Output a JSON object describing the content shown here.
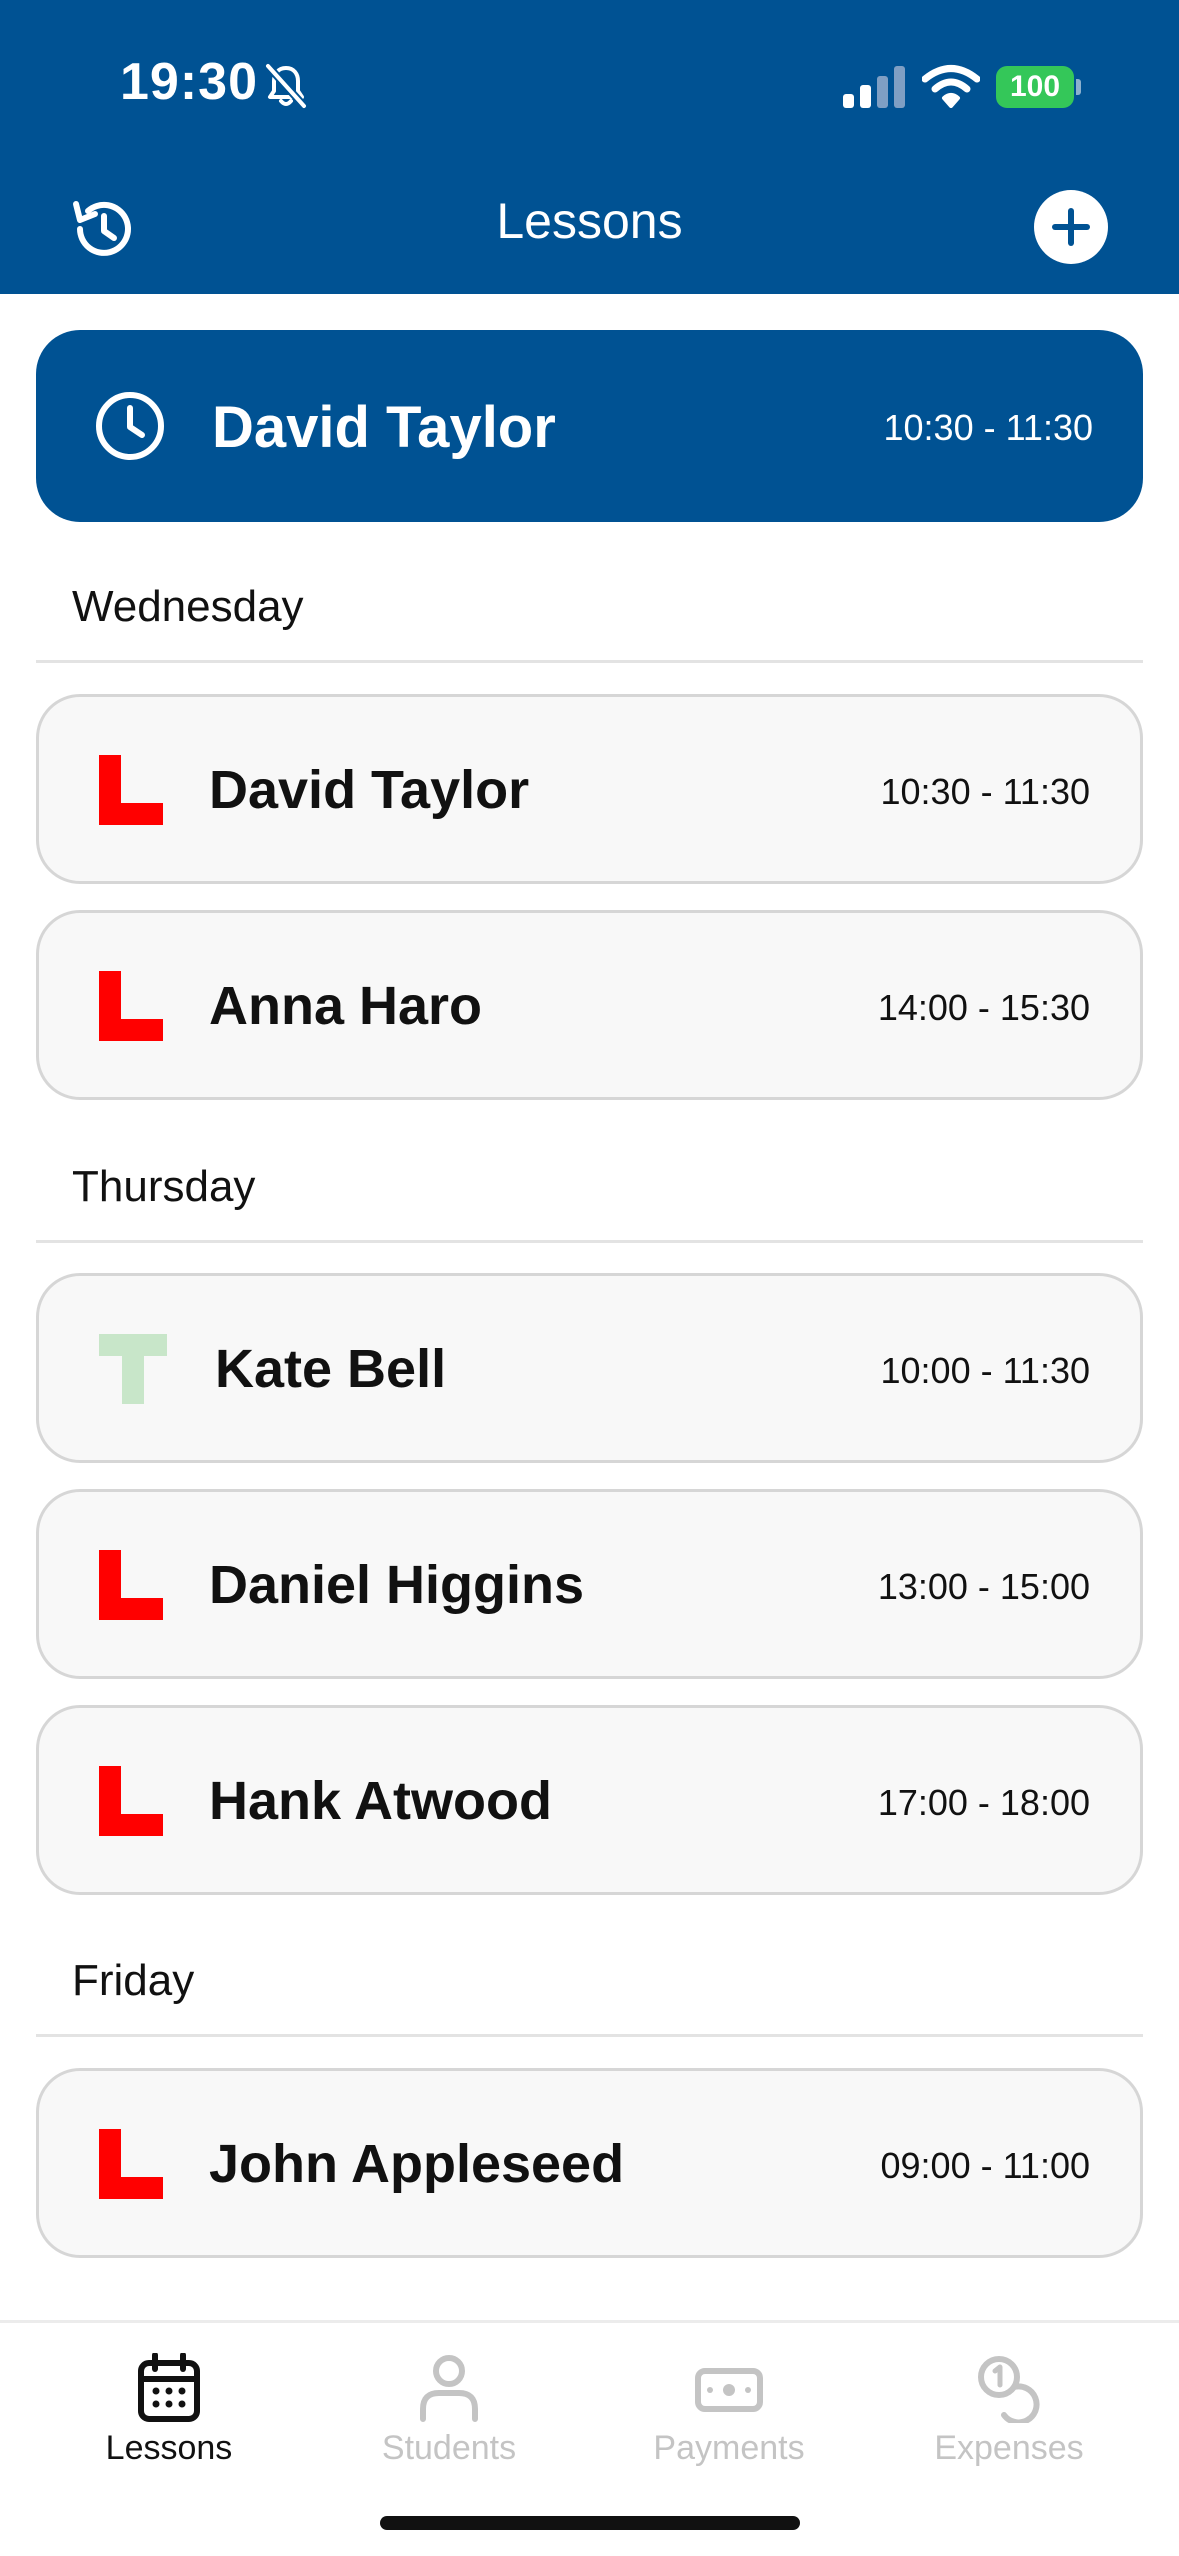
{
  "status_bar": {
    "time": "19:30",
    "battery": "100"
  },
  "nav": {
    "title": "Lessons",
    "left_icon": "history-icon",
    "right_icon": "plus-icon"
  },
  "current_lesson": {
    "name": "David Taylor",
    "time": "10:30 - 11:30",
    "icon": "clock-icon"
  },
  "sections": [
    {
      "day": "Wednesday",
      "lessons": [
        {
          "plate": "L",
          "name": "David Taylor",
          "time": "10:30 - 11:30"
        },
        {
          "plate": "L",
          "name": "Anna Haro",
          "time": "14:00 - 15:30"
        }
      ]
    },
    {
      "day": "Thursday",
      "lessons": [
        {
          "plate": "T",
          "name": "Kate Bell",
          "time": "10:00 - 11:30"
        },
        {
          "plate": "L",
          "name": "Daniel Higgins",
          "time": "13:00 - 15:00"
        },
        {
          "plate": "L",
          "name": "Hank Atwood",
          "time": "17:00 - 18:00"
        }
      ]
    },
    {
      "day": "Friday",
      "lessons": [
        {
          "plate": "L",
          "name": "John Appleseed",
          "time": "09:00 - 11:00"
        }
      ]
    }
  ],
  "tabs": [
    {
      "label": "Lessons",
      "icon": "calendar-icon",
      "active": true
    },
    {
      "label": "Students",
      "icon": "person-icon",
      "active": false
    },
    {
      "label": "Payments",
      "icon": "banknote-icon",
      "active": false
    },
    {
      "label": "Expenses",
      "icon": "coins-icon",
      "active": false
    }
  ],
  "colors": {
    "brand_blue": "#005293",
    "l_plate_red": "#ff0000",
    "t_plate_green": "#c8e6c9",
    "battery_green": "#34c759"
  }
}
